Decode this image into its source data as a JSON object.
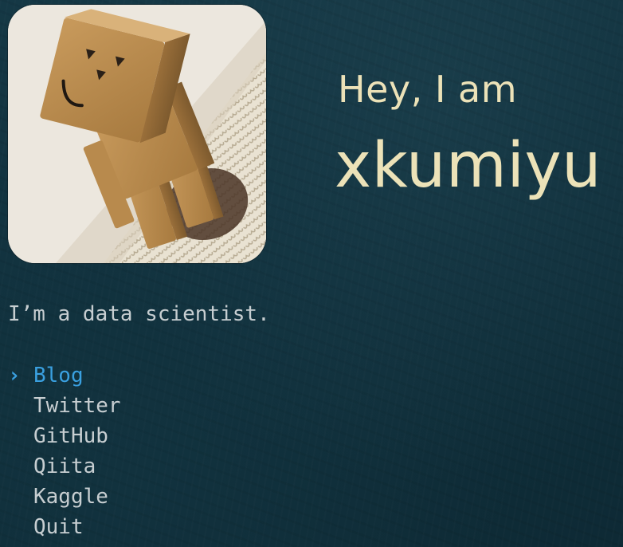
{
  "header": {
    "greeting": "Hey, I am",
    "username": "xkumiyu"
  },
  "profile": {
    "tagline": "I’m a data scientist."
  },
  "menu": {
    "pointer": "›",
    "selected_index": 0,
    "items": [
      {
        "label": "Blog"
      },
      {
        "label": "Twitter"
      },
      {
        "label": "GitHub"
      },
      {
        "label": "Qiita"
      },
      {
        "label": "Kaggle"
      },
      {
        "label": "Quit"
      }
    ]
  },
  "colors": {
    "background": "#10303c",
    "heading": "#ece2b8",
    "text": "#c7ced1",
    "accent": "#3aa0e0"
  }
}
